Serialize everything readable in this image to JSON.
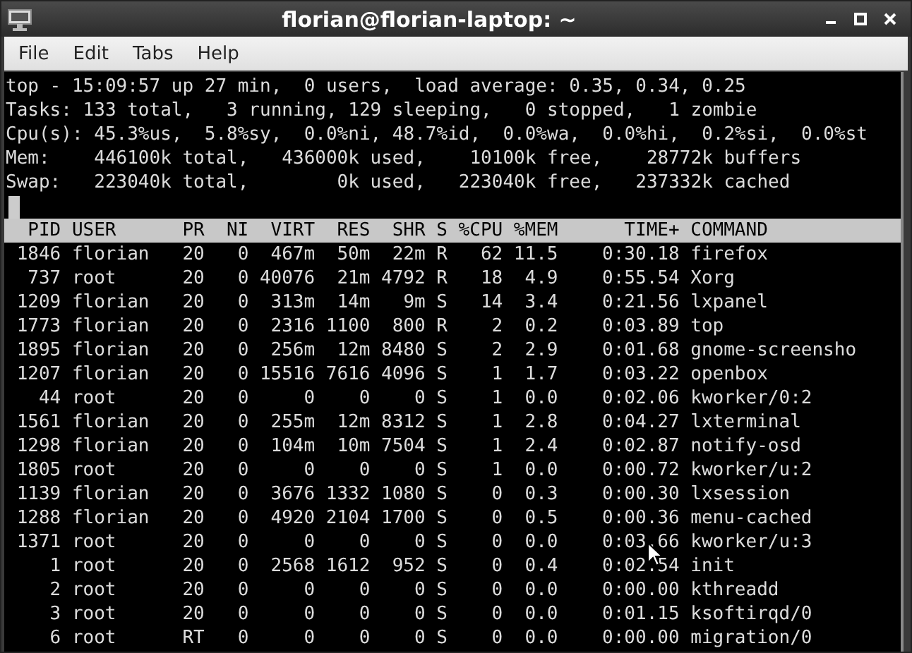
{
  "window": {
    "title": "florian@florian-laptop: ~"
  },
  "menu": [
    "File",
    "Edit",
    "Tabs",
    "Help"
  ],
  "summary": [
    "top - 15:09:57 up 27 min,  0 users,  load average: 0.35, 0.34, 0.25",
    "Tasks: 133 total,   3 running, 129 sleeping,   0 stopped,   1 zombie",
    "Cpu(s): 45.3%us,  5.8%sy,  0.0%ni, 48.7%id,  0.0%wa,  0.0%hi,  0.2%si,  0.0%st",
    "Mem:    446100k total,   436000k used,    10100k free,    28772k buffers",
    "Swap:   223040k total,        0k used,   223040k free,   237332k cached"
  ],
  "table": {
    "columns": [
      "PID",
      "USER",
      "PR",
      "NI",
      "VIRT",
      "RES",
      "SHR",
      "S",
      "%CPU",
      "%MEM",
      "TIME+",
      "COMMAND"
    ],
    "rows": [
      [
        "1846",
        "florian",
        "20",
        "0",
        "467m",
        "50m",
        "22m",
        "R",
        "62",
        "11.5",
        "0:30.18",
        "firefox"
      ],
      [
        "737",
        "root",
        "20",
        "0",
        "40076",
        "21m",
        "4792",
        "R",
        "18",
        "4.9",
        "0:55.54",
        "Xorg"
      ],
      [
        "1209",
        "florian",
        "20",
        "0",
        "313m",
        "14m",
        "9m",
        "S",
        "14",
        "3.4",
        "0:21.56",
        "lxpanel"
      ],
      [
        "1773",
        "florian",
        "20",
        "0",
        "2316",
        "1100",
        "800",
        "R",
        "2",
        "0.2",
        "0:03.89",
        "top"
      ],
      [
        "1895",
        "florian",
        "20",
        "0",
        "256m",
        "12m",
        "8480",
        "S",
        "2",
        "2.9",
        "0:01.68",
        "gnome-screensho"
      ],
      [
        "1207",
        "florian",
        "20",
        "0",
        "15516",
        "7616",
        "4096",
        "S",
        "1",
        "1.7",
        "0:03.22",
        "openbox"
      ],
      [
        "44",
        "root",
        "20",
        "0",
        "0",
        "0",
        "0",
        "S",
        "1",
        "0.0",
        "0:02.06",
        "kworker/0:2"
      ],
      [
        "1561",
        "florian",
        "20",
        "0",
        "255m",
        "12m",
        "8312",
        "S",
        "1",
        "2.8",
        "0:04.27",
        "lxterminal"
      ],
      [
        "1298",
        "florian",
        "20",
        "0",
        "104m",
        "10m",
        "7504",
        "S",
        "1",
        "2.4",
        "0:02.87",
        "notify-osd"
      ],
      [
        "1805",
        "root",
        "20",
        "0",
        "0",
        "0",
        "0",
        "S",
        "1",
        "0.0",
        "0:00.72",
        "kworker/u:2"
      ],
      [
        "1139",
        "florian",
        "20",
        "0",
        "3676",
        "1332",
        "1080",
        "S",
        "0",
        "0.3",
        "0:00.30",
        "lxsession"
      ],
      [
        "1288",
        "florian",
        "20",
        "0",
        "4920",
        "2104",
        "1700",
        "S",
        "0",
        "0.5",
        "0:00.36",
        "menu-cached"
      ],
      [
        "1371",
        "root",
        "20",
        "0",
        "0",
        "0",
        "0",
        "S",
        "0",
        "0.0",
        "0:03.66",
        "kworker/u:3"
      ],
      [
        "1",
        "root",
        "20",
        "0",
        "2568",
        "1612",
        "952",
        "S",
        "0",
        "0.4",
        "0:02.54",
        "init"
      ],
      [
        "2",
        "root",
        "20",
        "0",
        "0",
        "0",
        "0",
        "S",
        "0",
        "0.0",
        "0:00.00",
        "kthreadd"
      ],
      [
        "3",
        "root",
        "20",
        "0",
        "0",
        "0",
        "0",
        "S",
        "0",
        "0.0",
        "0:01.15",
        "ksoftirqd/0"
      ],
      [
        "6",
        "root",
        "RT",
        "0",
        "0",
        "0",
        "0",
        "S",
        "0",
        "0.0",
        "0:00.00",
        "migration/0"
      ]
    ]
  }
}
